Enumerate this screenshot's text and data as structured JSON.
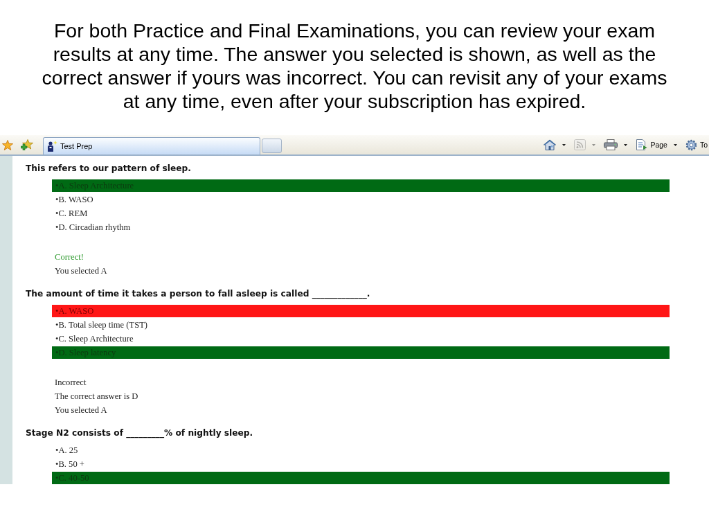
{
  "caption": "For both Practice and Final Examinations, you can review your exam results at any time. The answer you selected is shown, as well as the correct answer if yours was incorrect. You can revisit any of your exams at any time, even after your subscription has expired.",
  "browser": {
    "tabs": [
      {
        "label": "Test Prep",
        "selected": true
      }
    ],
    "command_bar": [
      {
        "kind": "home",
        "disabled": false
      },
      {
        "kind": "feeds",
        "disabled": true
      },
      {
        "kind": "print",
        "disabled": false
      },
      {
        "kind": "page",
        "label": "Page",
        "disabled": false
      },
      {
        "kind": "tools",
        "label": "To",
        "disabled": false
      }
    ],
    "questions": [
      {
        "prompt": "This refers to our pattern of sleep.",
        "options": [
          {
            "text": "•A. Sleep Architecture",
            "correct": true,
            "wrong": false
          },
          {
            "text": "•B. WASO",
            "correct": false,
            "wrong": false
          },
          {
            "text": "•C. REM",
            "correct": false,
            "wrong": false
          },
          {
            "text": "•D. Circadian rhythm",
            "correct": false,
            "wrong": false
          }
        ],
        "feedback": [
          {
            "text": "Correct!",
            "kind": "success"
          },
          {
            "text": "You selected A",
            "kind": "plain"
          }
        ]
      },
      {
        "prompt": "The amount of time it takes a person to fall asleep is called _____________.",
        "options": [
          {
            "text": "•A. WASO",
            "correct": false,
            "wrong": true
          },
          {
            "text": "•B. Total sleep time (TST)",
            "correct": false,
            "wrong": false
          },
          {
            "text": "•C. Sleep Architecture",
            "correct": false,
            "wrong": false
          },
          {
            "text": "•D. Sleep latency",
            "correct": true,
            "wrong": false
          }
        ],
        "feedback": [
          {
            "text": "Incorrect",
            "kind": "plain"
          },
          {
            "text": "The correct answer is D",
            "kind": "plain"
          },
          {
            "text": "You selected A",
            "kind": "plain"
          }
        ]
      },
      {
        "prompt": "Stage N2 consists of _________% of nightly sleep.",
        "options": [
          {
            "text": "•A. 25",
            "correct": false,
            "wrong": false
          },
          {
            "text": "•B. 50 +",
            "correct": false,
            "wrong": false
          },
          {
            "text": "•C. 40-50",
            "correct": true,
            "wrong": false
          }
        ]
      }
    ]
  }
}
